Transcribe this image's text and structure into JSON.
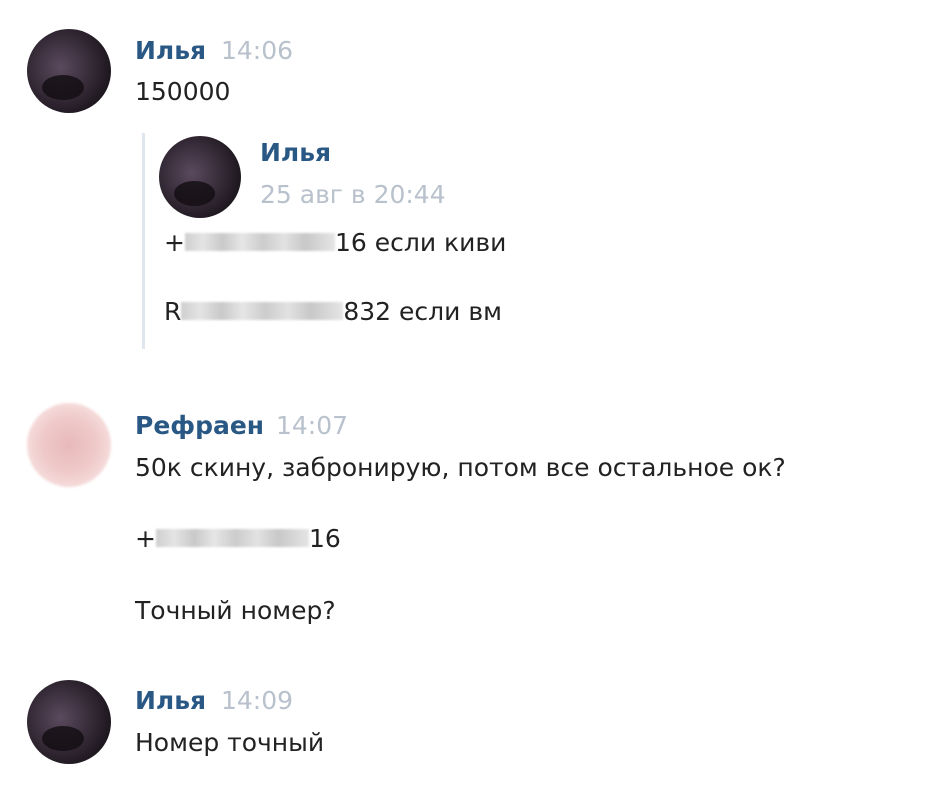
{
  "messages": [
    {
      "author": "Илья",
      "time": "14:06",
      "text": "150000",
      "forwarded": {
        "author": "Илья",
        "date": "25 авг в 20:44",
        "line1_prefix": "+",
        "line1_suffix": "16 если киви",
        "line2_prefix": "R",
        "line2_suffix": "832 если вм"
      }
    },
    {
      "author": "Рефраен",
      "time": "14:07",
      "line1": "50к скину, забронирую, потом все остальное ок?",
      "line2_prefix": "+",
      "line2_suffix": "16",
      "line3": "Точный номер?"
    },
    {
      "author": "Илья",
      "time": "14:09",
      "text": "Номер точный"
    }
  ]
}
